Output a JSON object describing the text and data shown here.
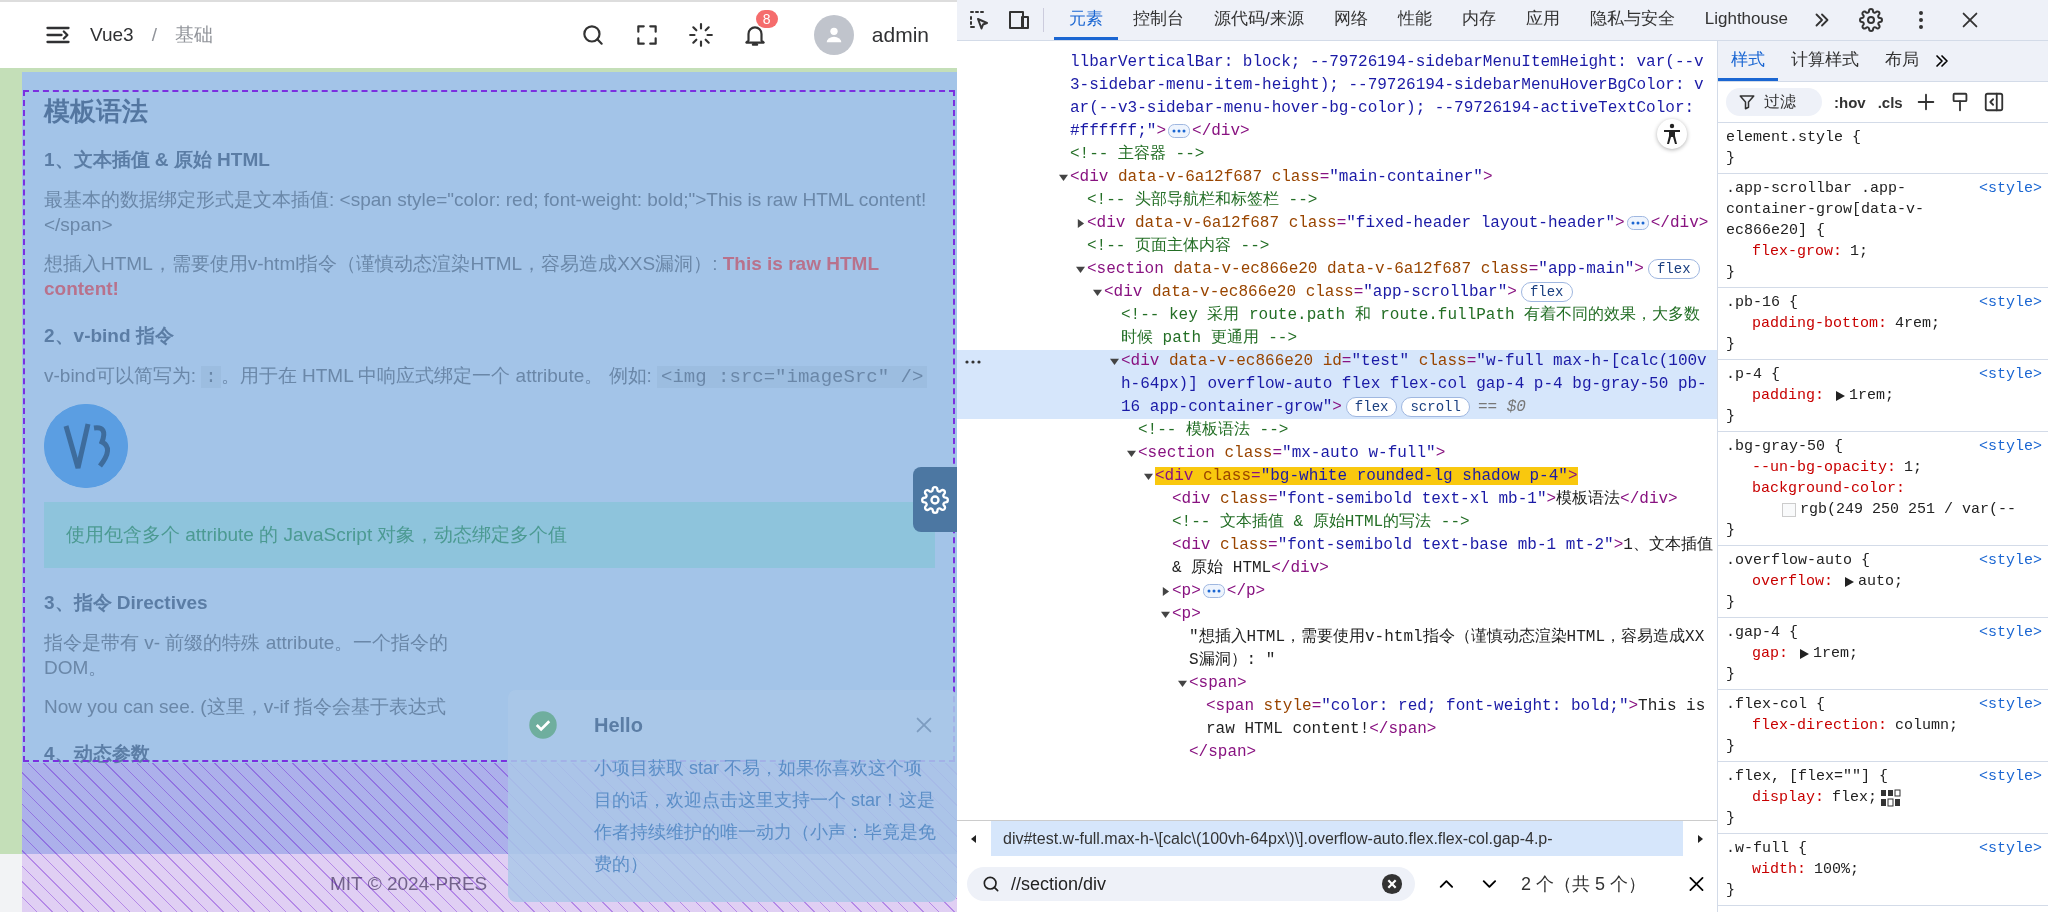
{
  "app": {
    "header": {
      "breadcrumb": [
        "Vue3",
        "/",
        "基础"
      ],
      "notification_badge": "8",
      "user": "admin"
    },
    "content": {
      "title": "模板语法",
      "blocks": [
        {
          "kind": "heading",
          "text": "1、文本插值 & 原始 HTML"
        },
        {
          "kind": "paragraph",
          "text": "最基本的数据绑定形式是文本插值: <span style=\"color: red; font-weight: bold;\">This is raw HTML content!</span>"
        },
        {
          "kind": "paragraph",
          "text": "想插入HTML，需要使用v-html指令（谨慎动态渲染HTML，容易造成XXS漏洞）: **This is raw HTML content!**"
        },
        {
          "kind": "heading",
          "text": "2、v-bind 指令"
        },
        {
          "kind": "mixed",
          "parts": [
            {
              "kind": "text",
              "text": "v-bind可以简写为: "
            },
            {
              "kind": "code",
              "text": ":"
            },
            {
              "kind": "text",
              "text": "。用于在 HTML 中响应式绑定一个 attribute。 例如: "
            },
            {
              "kind": "code",
              "text": "<img :src=\"imageSrc\" />"
            }
          ]
        },
        {
          "kind": "logo"
        },
        {
          "kind": "tip",
          "text": "使用包含多个 attribute 的 JavaScript 对象，动态绑定多个值"
        },
        {
          "kind": "heading",
          "text": "3、指令 Directives"
        },
        {
          "kind": "lines",
          "lines": [
            "指令是带有 v- 前缀的特殊 attribute。一个指令的",
            "DOM。"
          ]
        },
        {
          "kind": "paragraph",
          "text": "Now you can see. (这里，v-if 指令会基于表达式"
        },
        {
          "kind": "heading",
          "text": "4、动态参数"
        }
      ]
    },
    "footer": "MIT © 2024-PRES",
    "toast": {
      "title": "Hello",
      "message": "小项目获取 star 不易，如果你喜欢这个项目的话，欢迎点击这里支持一个 star！这是作者持续维护的唯一动力（小声：毕竟是免费的）"
    }
  },
  "devtools": {
    "tabs": [
      {
        "label": "元素",
        "selected": true
      },
      {
        "label": "控制台",
        "selected": false
      },
      {
        "label": "源代码/来源",
        "selected": false
      },
      {
        "label": "网络",
        "selected": false
      },
      {
        "label": "性能",
        "selected": false
      },
      {
        "label": "内存",
        "selected": false
      },
      {
        "label": "应用",
        "selected": false
      },
      {
        "label": "隐私与安全",
        "selected": false
      },
      {
        "label": "Lighthouse",
        "selected": false
      }
    ],
    "dom_tree": [
      {
        "kind": "fragment",
        "text": "llbarVerticalBar: block; --79726194-sidebarMenuItemHeight: var(--v3-sidebar-menu-item-height); --79726194-sidebarMenuHoverBgColor: var(--v3-sidebar-menu-hover-bg-color); --79726194-activeTextColor: #ffffff;\">",
        "close": "</div>",
        "selected": false,
        "highlighted": false
      },
      {
        "kind": "comment",
        "text": "<!-- 主容器 -->",
        "selected": false
      },
      {
        "kind": "element",
        "text": "<div data-v-6a12f687 class=\"main-container\">",
        "expanded": true,
        "selected": false,
        "highlighted": false,
        "children": [
          {
            "kind": "comment",
            "text": "<!-- 头部导航栏和标签栏 -->",
            "selected": false
          },
          {
            "kind": "element",
            "text": "<div data-v-6a12f687 class=\"fixed-header layout-header\">",
            "expanded": false,
            "close": "</div>",
            "selected": false,
            "highlighted": false
          },
          {
            "kind": "comment",
            "text": "<!-- 页面主体内容 -->",
            "selected": false
          },
          {
            "kind": "element",
            "text": "<section data-v-ec866e20 data-v-6a12f687 class=\"app-main\">",
            "badges": [
              "flex"
            ],
            "expanded": true,
            "selected": false,
            "highlighted": false,
            "children": [
              {
                "kind": "element",
                "text": "<div data-v-ec866e20 class=\"app-scrollbar\">",
                "badges": [
                  "flex"
                ],
                "expanded": true,
                "selected": false,
                "highlighted": false,
                "children": [
                  {
                    "kind": "comment",
                    "text": "<!-- key 采用 route.path 和 route.fullPath 有着不同的效果，大多数时候 path 更通用 -->",
                    "selected": false
                  },
                  {
                    "kind": "element",
                    "text": "<div data-v-ec866e20 id=\"test\" class=\"w-full max-h-[calc(100vh-64px)] overflow-auto flex flex-col gap-4 p-4 bg-gray-50 pb-16 app-container-grow\">",
                    "badges": [
                      "flex",
                      "scroll"
                    ],
                    "suffix": "== $0",
                    "expanded": true,
                    "selected": true,
                    "highlighted": false,
                    "children": [
                      {
                        "kind": "comment",
                        "text": "<!-- 模板语法 -->",
                        "selected": false
                      },
                      {
                        "kind": "element",
                        "text": "<section class=\"mx-auto w-full\">",
                        "expanded": true,
                        "selected": false,
                        "highlighted": false,
                        "children": [
                          {
                            "kind": "element",
                            "text": "<div class=\"bg-white rounded-lg shadow p-4\">",
                            "expanded": true,
                            "selected": false,
                            "highlighted": true,
                            "children": [
                              {
                                "kind": "element",
                                "text": "<div class=\"font-semibold text-xl mb-1\">模板语法</div>",
                                "selected": false,
                                "highlighted": false
                              },
                              {
                                "kind": "comment",
                                "text": "<!-- 文本插值 & 原始HTML的写法 -->",
                                "selected": false
                              },
                              {
                                "kind": "element",
                                "text": "<div class=\"font-semibold text-base mb-1 mt-2\">1、文本插值 & 原始 HTML</div>",
                                "selected": false,
                                "highlighted": false
                              },
                              {
                                "kind": "element",
                                "text": "<p>",
                                "expanded": false,
                                "close": "</p>",
                                "selected": false,
                                "highlighted": false
                              },
                              {
                                "kind": "element",
                                "text": "<p>",
                                "expanded": true,
                                "selected": false,
                                "highlighted": false,
                                "children": [
                                  {
                                    "kind": "text",
                                    "text": "\"想插入HTML，需要使用v-html指令（谨慎动态渲染HTML，容易造成XXS漏洞）: \"",
                                    "selected": false
                                  },
                                  {
                                    "kind": "element",
                                    "text": "<span>",
                                    "expanded": true,
                                    "close": "</span>",
                                    "selected": false,
                                    "highlighted": false,
                                    "children": [
                                      {
                                        "kind": "element",
                                        "text": "<span style=\"color: red; font-weight: bold;\">This is raw HTML content!</span>",
                                        "selected": false,
                                        "highlighted": false
                                      }
                                    ]
                                  }
                                ]
                              }
                            ]
                          }
                        ]
                      }
                    ]
                  }
                ]
              }
            ]
          }
        ]
      }
    ],
    "crumb": "div#test.w-full.max-h-\\[calc\\(100vh-64px\\)\\].overflow-auto.flex.flex-col.gap-4.p-",
    "search": {
      "value": "//section/div",
      "count": "2 个（共 5 个）"
    },
    "styles": {
      "tabs": [
        {
          "label": "样式",
          "selected": true
        },
        {
          "label": "计算样式",
          "selected": false
        },
        {
          "label": "布局",
          "selected": false
        }
      ],
      "filter_placeholder": "过滤",
      "hov": ":hov",
      "cls": ".cls",
      "rules": [
        {
          "selector": "element.style {",
          "close": "}"
        },
        {
          "selector": ".app-scrollbar .app-container-grow[data-v-ec866e20] {",
          "source": "<style>",
          "props": [
            {
              "kind": "plain",
              "name": "flex-grow:",
              "value": "1;"
            }
          ],
          "close": "}"
        },
        {
          "selector": ".pb-16 {",
          "source": "<style>",
          "props": [
            {
              "kind": "plain",
              "name": "padding-bottom:",
              "value": "4rem;"
            }
          ],
          "close": "}"
        },
        {
          "selector": ".p-4 {",
          "source": "<style>",
          "props": [
            {
              "kind": "shorthand",
              "name": "padding:",
              "value": "1rem;"
            }
          ],
          "close": "}"
        },
        {
          "selector": ".bg-gray-50 {",
          "source": "<style>",
          "props": [
            {
              "kind": "plain",
              "name": "--un-bg-opacity:",
              "value": "1;"
            },
            {
              "kind": "color",
              "name": "background-color:",
              "value": "rgb(249 250 251 / var(--",
              "color": "#f9fafb"
            }
          ],
          "close": "}"
        },
        {
          "selector": ".overflow-auto {",
          "source": "<style>",
          "props": [
            {
              "kind": "shorthand",
              "name": "overflow:",
              "value": "auto;"
            }
          ],
          "close": "}"
        },
        {
          "selector": ".gap-4 {",
          "source": "<style>",
          "props": [
            {
              "kind": "shorthand",
              "name": "gap:",
              "value": "1rem;"
            }
          ],
          "close": "}"
        },
        {
          "selector": ".flex-col {",
          "source": "<style>",
          "props": [
            {
              "kind": "plain",
              "name": "flex-direction:",
              "value": "column;"
            }
          ],
          "close": "}"
        },
        {
          "selector": ".flex, [flex=\"\"] {",
          "source": "<style>",
          "props": [
            {
              "kind": "flex",
              "name": "display:",
              "value": "flex;"
            }
          ],
          "close": "}"
        },
        {
          "selector": ".w-full {",
          "source": "<style>",
          "props": [
            {
              "kind": "plain",
              "name": "width:",
              "value": "100%;"
            }
          ],
          "close": "}"
        }
      ]
    }
  }
}
